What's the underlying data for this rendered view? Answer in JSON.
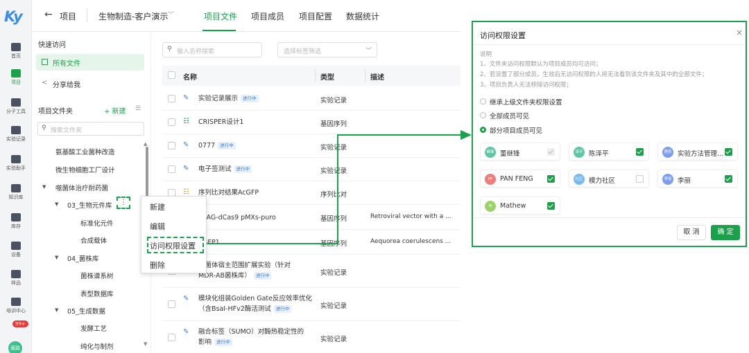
{
  "logo": {
    "text": "Ky"
  },
  "rail": {
    "items": [
      "首页",
      "项目",
      "分子工具",
      "实验记录",
      "实验助手",
      "知识库",
      "库存",
      "设备",
      "样品",
      "培训中心"
    ],
    "badge": "99+",
    "avatar": "唐路"
  },
  "topbar": {
    "back_icon": "back-arrow-icon",
    "crumb1": "项目",
    "crumb2": "生物制造-客户演示",
    "tabs": [
      "项目文件",
      "项目成员",
      "项目配置",
      "数据统计"
    ],
    "active_tab": 0
  },
  "sidebar": {
    "quick_access": "快速访问",
    "all_files": "所有文件",
    "shared": "分享给我",
    "folder_title": "项目文件夹",
    "new_label": "+ 新建",
    "search_placeholder": "搜索文件夹",
    "tree": [
      {
        "label": "氨基酸工业菌种改造",
        "level": 1,
        "caret": ""
      },
      {
        "label": "微生物细胞工厂设计",
        "level": 1,
        "caret": ""
      },
      {
        "label": "噬菌体治疗耐药菌",
        "level": 1,
        "caret": "▼"
      },
      {
        "label": "03_生物元件库",
        "level": 2,
        "caret": "▼"
      },
      {
        "label": "标准化元件",
        "level": 3,
        "caret": ""
      },
      {
        "label": "合成载体",
        "level": 3,
        "caret": ""
      },
      {
        "label": "04_菌株库",
        "level": 2,
        "caret": "▼"
      },
      {
        "label": "菌株谱系树",
        "level": 3,
        "caret": ""
      },
      {
        "label": "表型数据库",
        "level": 3,
        "caret": ""
      },
      {
        "label": "05_生成数据",
        "level": 2,
        "caret": "▼"
      },
      {
        "label": "发酵工艺",
        "level": 3,
        "caret": ""
      },
      {
        "label": "纯化与制剂",
        "level": 3,
        "caret": ""
      }
    ],
    "more_icon": "⋮"
  },
  "main": {
    "search_placeholder": "输入名称搜索",
    "filter_placeholder": "选择标签筛选",
    "columns": {
      "name": "名称",
      "type": "类型",
      "desc": "描述"
    },
    "rows": [
      {
        "name": "实验记录展示",
        "status": "进行中",
        "type": "实验记录",
        "desc": "",
        "icon": "✎"
      },
      {
        "name": "CRISPER设计1",
        "status": "",
        "type": "基因序列",
        "desc": "",
        "icon": "☷"
      },
      {
        "name": "0777",
        "status": "进行中",
        "type": "实验记录",
        "desc": "",
        "icon": "✎"
      },
      {
        "name": "电子签测试",
        "status": "进行中",
        "type": "实验记录",
        "desc": "",
        "icon": "✎"
      },
      {
        "name": "序列比对结果AcGFP",
        "status": "",
        "type": "序列比对",
        "desc": "",
        "icon": "☷"
      },
      {
        "name": "pLAG-dCas9 pMXs-puro",
        "status": "",
        "type": "基因序列",
        "desc": "Retroviral vector with a ...",
        "icon": "☷"
      },
      {
        "name": "pGFP1",
        "status": "",
        "type": "基因序列",
        "desc": "Aequorea coerulescens ...",
        "icon": "☷"
      },
      {
        "name": "噬菌体宿主范围扩展实验（针对",
        "name2": "MDR-AB菌株库）",
        "status": "进行中",
        "type": "实验记录",
        "desc": "",
        "icon": "✎"
      },
      {
        "name": "模块化组装Golden Gate反应效率优化",
        "name2": "（含BsaI-HFv2酶活测试",
        "status": "进行中",
        "type": "实验记录",
        "desc": "",
        "icon": "✎"
      },
      {
        "name": "融合标签（SUMO）对酶热稳定性的",
        "name2": "影响",
        "status": "进行中",
        "type": "实验记录",
        "desc": "",
        "icon": "✎"
      }
    ]
  },
  "context_menu": {
    "items": [
      "新建",
      "编辑",
      "访问权限设置",
      "删除"
    ],
    "highlighted": 2
  },
  "dialog": {
    "title": "访问权限设置",
    "close": "×",
    "notes": [
      "说明",
      "1、文件夹访问权限默认为项目成员均可访问；",
      "2、若设置了部分成员，生效后无访问权限的人将无法看到该文件夹及其中的全部文件；",
      "3、项目负责人无法移除访问权限；"
    ],
    "options": [
      "继承上级文件夹权限设置",
      "全部成员可见",
      "部分项目成员可见"
    ],
    "selected_option": 2,
    "members": [
      {
        "name": "董继锋",
        "avatar": "继锋",
        "color": "#5cc7a0",
        "check": "disabled"
      },
      {
        "name": "陈泽平",
        "avatar": "泽平",
        "color": "#5cc7a0",
        "check": "on"
      },
      {
        "name": "实验方法管理...",
        "avatar": "理员",
        "color": "#7c9cf0",
        "check": "on"
      },
      {
        "name": "PAN FENG",
        "avatar": "PF",
        "color": "#f07c7c",
        "check": "on"
      },
      {
        "name": "模力社区",
        "avatar": "社区",
        "color": "#7ab8f0",
        "check": "off"
      },
      {
        "name": "李丽",
        "avatar": "李丽",
        "color": "#7c9cf0",
        "check": "on"
      },
      {
        "name": "Mathew",
        "avatar": "M",
        "color": "#9ad36a",
        "check": "on"
      }
    ],
    "cancel": "取 消",
    "ok": "确 定"
  }
}
